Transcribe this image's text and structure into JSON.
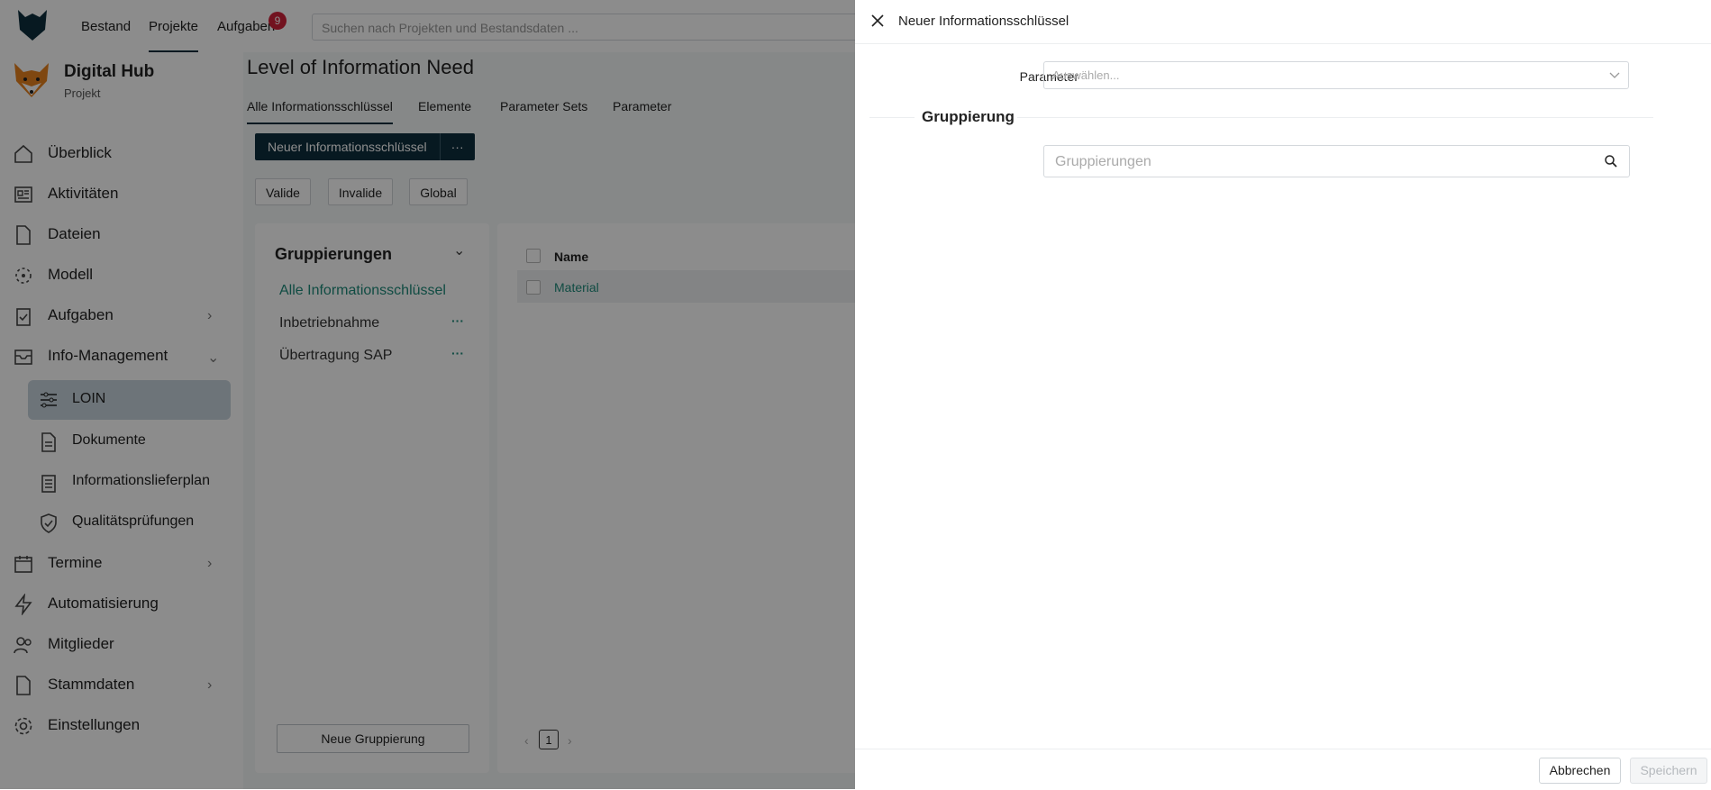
{
  "topnav": {
    "items": [
      "Bestand",
      "Projekte",
      "Aufgaben"
    ],
    "active": "Projekte",
    "tasks_badge": "9",
    "search_placeholder": "Suchen nach Projekten und Bestandsdaten ..."
  },
  "project": {
    "name": "Digital Hub",
    "type": "Projekt"
  },
  "sidebar": {
    "items": [
      {
        "label": "Überblick",
        "icon": "home-icon"
      },
      {
        "label": "Aktivitäten",
        "icon": "newspaper-icon"
      },
      {
        "label": "Dateien",
        "icon": "file-icon"
      },
      {
        "label": "Modell",
        "icon": "model-icon"
      },
      {
        "label": "Aufgaben",
        "icon": "clipboard-check-icon",
        "expandable": true
      },
      {
        "label": "Info-Management",
        "icon": "inbox-icon",
        "expanded": true
      }
    ],
    "subitems": [
      {
        "label": "LOIN",
        "icon": "sliders-icon",
        "active": true
      },
      {
        "label": "Dokumente",
        "icon": "document-icon"
      },
      {
        "label": "Informationslieferplan",
        "icon": "clipboard-list-icon"
      },
      {
        "label": "Qualitätsprüfungen",
        "icon": "shield-check-icon"
      }
    ],
    "items_bottom": [
      {
        "label": "Termine",
        "icon": "calendar-icon",
        "expandable": true
      },
      {
        "label": "Automatisierung",
        "icon": "bolt-icon"
      },
      {
        "label": "Mitglieder",
        "icon": "users-icon"
      },
      {
        "label": "Stammdaten",
        "icon": "database-icon",
        "expandable": true
      },
      {
        "label": "Einstellungen",
        "icon": "gear-icon"
      }
    ]
  },
  "page": {
    "title": "Level of Information Need",
    "tabs": [
      "Alle Informationsschlüssel",
      "Elemente",
      "Parameter Sets",
      "Parameter"
    ],
    "active_tab": "Alle Informationsschlüssel",
    "new_button": "Neuer Informationsschlüssel",
    "more_button": "···",
    "filters": [
      "Valide",
      "Invalide",
      "Global"
    ]
  },
  "groups_panel": {
    "title": "Gruppierungen",
    "items": [
      "Alle Informationsschlüssel",
      "Inbetriebnahme",
      "Übertragung SAP"
    ],
    "item_more": "···",
    "new_button": "Neue Gruppierung"
  },
  "table": {
    "columns": [
      "Name"
    ],
    "rows": [
      [
        "Material"
      ]
    ],
    "pager": {
      "current": "1"
    }
  },
  "drawer": {
    "title": "Neuer Informationsschlüssel",
    "parameter_label": "Parameter",
    "parameter_placeholder": "Auswählen...",
    "section_title": "Gruppierung",
    "group_search_placeholder": "Gruppierungen",
    "cancel": "Abbrechen",
    "save": "Speichern"
  },
  "colors": {
    "primary_dark": "#0e2e3d",
    "accent_teal": "#1e8a7a",
    "badge_red": "#d0213a",
    "active_nav_bg": "#c7d3dc"
  }
}
